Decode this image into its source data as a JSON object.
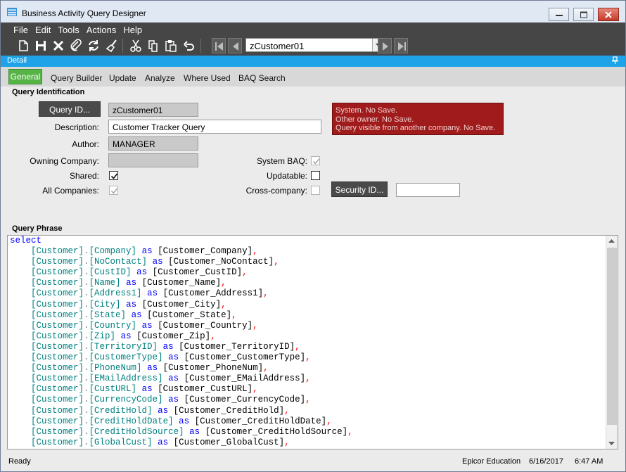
{
  "window": {
    "title": "Business Activity Query Designer"
  },
  "menu": [
    "File",
    "Edit",
    "Tools",
    "Actions",
    "Help"
  ],
  "toolbar": {
    "record_value": "zCustomer01"
  },
  "panel": {
    "title": "Detail"
  },
  "tabs": [
    "General",
    "Query Builder",
    "Update",
    "Analyze",
    "Where Used",
    "BAQ Search"
  ],
  "identification": {
    "header": "Query Identification",
    "query_id_button": "Query ID...",
    "query_id_value": "zCustomer01",
    "description_label": "Description:",
    "description_value": "Customer Tracker Query",
    "author_label": "Author:",
    "author_value": "MANAGER",
    "owning_company_label": "Owning Company:",
    "owning_company_value": "",
    "shared_label": "Shared:",
    "all_companies_label": "All Companies:",
    "system_baq_label": "System BAQ:",
    "updatable_label": "Updatable:",
    "cross_company_label": "Cross-company:",
    "security_button": "Security ID...",
    "security_value": "",
    "messages": [
      "System. No Save.",
      "Other owner. No Save.",
      "Query visible from another company. No Save."
    ]
  },
  "query_phrase": {
    "header": "Query Phrase",
    "keyword": "select",
    "rows": [
      {
        "table": "[Customer]",
        "field": "[Company]",
        "alias": "[Customer_Company]"
      },
      {
        "table": "[Customer]",
        "field": "[NoContact]",
        "alias": "[Customer_NoContact]"
      },
      {
        "table": "[Customer]",
        "field": "[CustID]",
        "alias": "[Customer_CustID]"
      },
      {
        "table": "[Customer]",
        "field": "[Name]",
        "alias": "[Customer_Name]"
      },
      {
        "table": "[Customer]",
        "field": "[Address1]",
        "alias": "[Customer_Address1]"
      },
      {
        "table": "[Customer]",
        "field": "[City]",
        "alias": "[Customer_City]"
      },
      {
        "table": "[Customer]",
        "field": "[State]",
        "alias": "[Customer_State]"
      },
      {
        "table": "[Customer]",
        "field": "[Country]",
        "alias": "[Customer_Country]"
      },
      {
        "table": "[Customer]",
        "field": "[Zip]",
        "alias": "[Customer_Zip]"
      },
      {
        "table": "[Customer]",
        "field": "[TerritoryID]",
        "alias": "[Customer_TerritoryID]"
      },
      {
        "table": "[Customer]",
        "field": "[CustomerType]",
        "alias": "[Customer_CustomerType]"
      },
      {
        "table": "[Customer]",
        "field": "[PhoneNum]",
        "alias": "[Customer_PhoneNum]"
      },
      {
        "table": "[Customer]",
        "field": "[EMailAddress]",
        "alias": "[Customer_EMailAddress]"
      },
      {
        "table": "[Customer]",
        "field": "[CustURL]",
        "alias": "[Customer_CustURL]"
      },
      {
        "table": "[Customer]",
        "field": "[CurrencyCode]",
        "alias": "[Customer_CurrencyCode]"
      },
      {
        "table": "[Customer]",
        "field": "[CreditHold]",
        "alias": "[Customer_CreditHold]"
      },
      {
        "table": "[Customer]",
        "field": "[CreditHoldDate]",
        "alias": "[Customer_CreditHoldDate]"
      },
      {
        "table": "[Customer]",
        "field": "[CreditHoldSource]",
        "alias": "[Customer_CreditHoldSource]"
      },
      {
        "table": "[Customer]",
        "field": "[GlobalCust]",
        "alias": "[Customer_GlobalCust]"
      }
    ]
  },
  "status": {
    "left": "Ready",
    "company": "Epicor Education",
    "date": "6/16/2017",
    "time": "6:47 AM"
  },
  "colors": {
    "accent": "#1fa3e8",
    "active_tab": "#56b447",
    "alert": "#a01c1c",
    "keyword": "#0000ff",
    "identifier": "#008080",
    "comma": "#ff0000"
  }
}
